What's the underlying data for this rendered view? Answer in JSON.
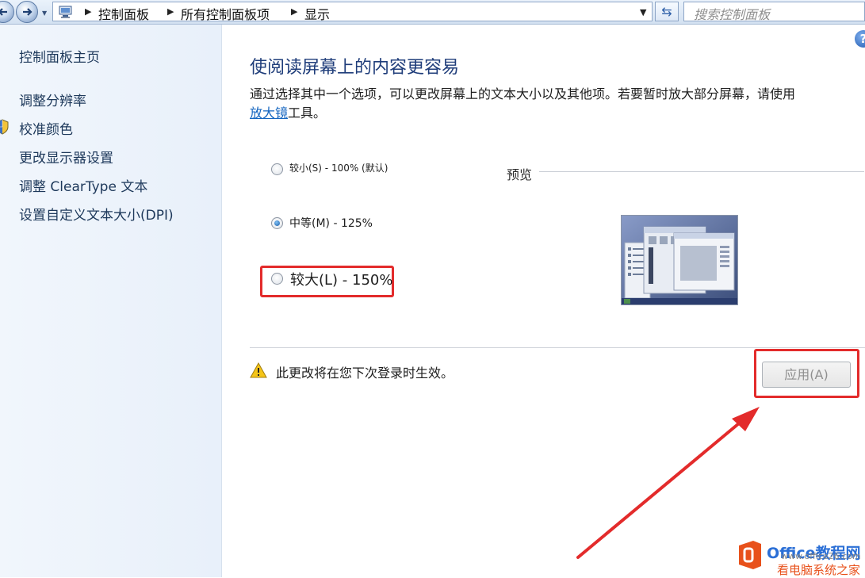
{
  "address_bar": {
    "breadcrumbs": [
      "控制面板",
      "所有控制面板项",
      "显示"
    ],
    "search_placeholder": "搜索控制面板"
  },
  "sidebar": {
    "items": [
      {
        "label": "控制面板主页"
      },
      {
        "label": "调整分辨率"
      },
      {
        "label": "校准颜色"
      },
      {
        "label": "更改显示器设置"
      },
      {
        "label": "调整 ClearType 文本"
      },
      {
        "label": "设置自定义文本大小(DPI)"
      }
    ]
  },
  "main": {
    "title": "使阅读屏幕上的内容更容易",
    "description_line1": "通过选择其中一个选项，可以更改屏幕上的文本大小以及其他项。若要暂时放大部分屏幕，请使用",
    "description_link": "放大镜",
    "description_suffix": "工具。",
    "options": [
      {
        "label": "较小(S) - 100% (默认)",
        "checked": false
      },
      {
        "label": "中等(M) - 125%",
        "checked": true
      },
      {
        "label": "较大(L) - 150%",
        "checked": false
      }
    ],
    "preview_label": "预览",
    "notice": "此更改将在您下次登录时生效。",
    "apply_label": "应用(A)",
    "help_label": "?"
  },
  "watermark": {
    "brand": "Office教程网",
    "url": "www.office26.com",
    "sub": "看电脑系统之家"
  },
  "colors": {
    "annotation": "#e32b2b",
    "link": "#1566c0",
    "title": "#1f3d7a"
  }
}
